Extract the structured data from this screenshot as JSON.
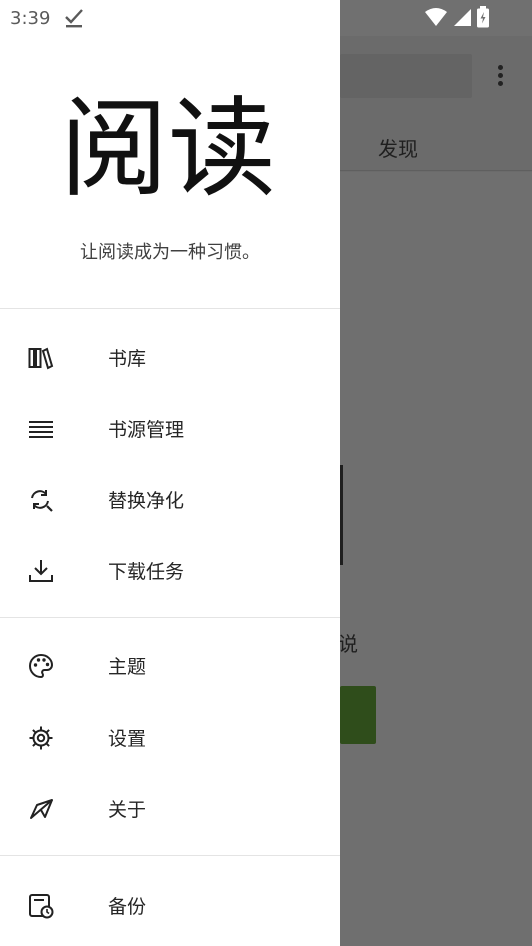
{
  "status_bar": {
    "time": "3:39",
    "check_glyph": "✓"
  },
  "background": {
    "tab_label": "发现",
    "partial_text": "说"
  },
  "drawer": {
    "logo_text": "阅读",
    "slogan": "让阅读成为一种习惯。",
    "items": [
      {
        "label": "书库",
        "icon": "bookshelf-icon"
      },
      {
        "label": "书源管理",
        "icon": "list-icon"
      },
      {
        "label": "替换净化",
        "icon": "replace-icon"
      },
      {
        "label": "下载任务",
        "icon": "download-icon"
      },
      {
        "label": "主题",
        "icon": "palette-icon"
      },
      {
        "label": "设置",
        "icon": "gear-icon"
      },
      {
        "label": "关于",
        "icon": "send-icon"
      },
      {
        "label": "备份",
        "icon": "backup-icon"
      }
    ]
  },
  "colors": {
    "drawer_bg": "#ffffff",
    "scrim": "#6f6f6f",
    "text": "#262626",
    "accent_green": "#2f4d1b"
  }
}
